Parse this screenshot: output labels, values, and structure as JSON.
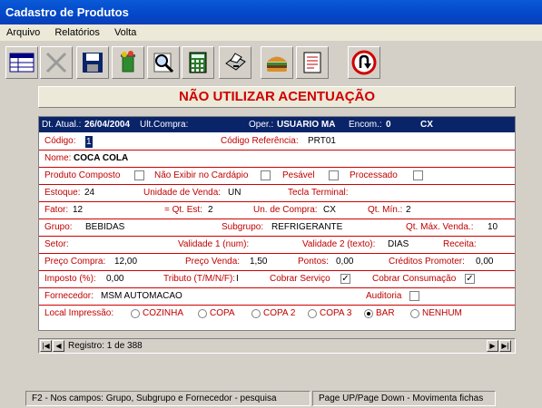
{
  "window": {
    "title": "Cadastro de Produtos"
  },
  "menu": [
    "Arquivo",
    "Relatórios",
    "Volta"
  ],
  "toolbar": [
    "table-icon",
    "cancel-x-icon",
    "save-floppy-icon",
    "recycle-bin-icon",
    "search-magnifier-icon",
    "calculator-icon",
    "print-icon",
    "burger-icon",
    "report-list-icon",
    "undo-return-icon"
  ],
  "banner": "NÃO UTILIZAR ACENTUAÇÃO",
  "header": {
    "dt_atual_label": "Dt. Atual.:",
    "dt_atual": "26/04/2004",
    "ult_compra_label": "Ult.Compra:",
    "oper_label": "Oper.:",
    "oper": "USUARIO MA",
    "encom_label": "Encom.:",
    "encom": "0",
    "unit": "CX"
  },
  "fields": {
    "codigo_label": "Código:",
    "codigo": "1",
    "codigo_ref_label": "Código Referência:",
    "codigo_ref": "PRT01",
    "nome_label": "Nome:",
    "nome": "COCA COLA",
    "produto_composto": "Produto Composto",
    "nao_exibir": "Não Exibir no Cardápio",
    "pesavel": "Pesável",
    "processado": "Processado",
    "estoque_label": "Estoque:",
    "estoque": "24",
    "unidade_venda_label": "Unidade de Venda:",
    "unidade_venda": "UN",
    "tecla_terminal_label": "Tecla Terminal:",
    "fator_label": "Fator:",
    "fator": "12",
    "qt_est_label": "= Qt. Est:",
    "qt_est": "2",
    "un_compra_label": "Un. de Compra:",
    "un_compra": "CX",
    "qt_min_label": "Qt. Mín.:",
    "qt_min": "2",
    "grupo_label": "Grupo:",
    "grupo": "BEBIDAS",
    "subgrupo_label": "Subgrupo:",
    "subgrupo": "REFRIGERANTE",
    "qt_max_label": "Qt. Máx. Venda.:",
    "qt_max": "10",
    "setor_label": "Setor:",
    "validade1_label": "Validade 1 (num):",
    "validade2_label": "Validade 2 (texto):",
    "validade2": "DIAS",
    "receita_label": "Receita:",
    "preco_compra_label": "Preço Compra:",
    "preco_compra": "12,00",
    "preco_venda_label": "Preço Venda:",
    "preco_venda": "1,50",
    "pontos_label": "Pontos:",
    "pontos": "0,00",
    "creditos_label": "Créditos Promoter:",
    "creditos": "0,00",
    "imposto_label": "Imposto (%):",
    "imposto": "0,00",
    "tributo_label": "Tributo (T/M/N/F):",
    "tributo": "I",
    "cobrar_servico": "Cobrar Serviço",
    "cobrar_consumacao": "Cobrar Consumação",
    "fornecedor_label": "Fornecedor:",
    "fornecedor": "MSM AUTOMACAO",
    "auditoria": "Auditoria",
    "local_label": "Local Impressão:",
    "local_options": [
      "COZINHA",
      "COPA",
      "COPA 2",
      "COPA 3",
      "BAR",
      "NENHUM"
    ],
    "local_selected": "BAR"
  },
  "nav": {
    "record": "Registro: 1 de 388"
  },
  "status": {
    "left": "F2 - Nos campos: Grupo, Subgrupo e Fornecedor - pesquisa",
    "right": "Page UP/Page Down - Movimenta fichas"
  }
}
